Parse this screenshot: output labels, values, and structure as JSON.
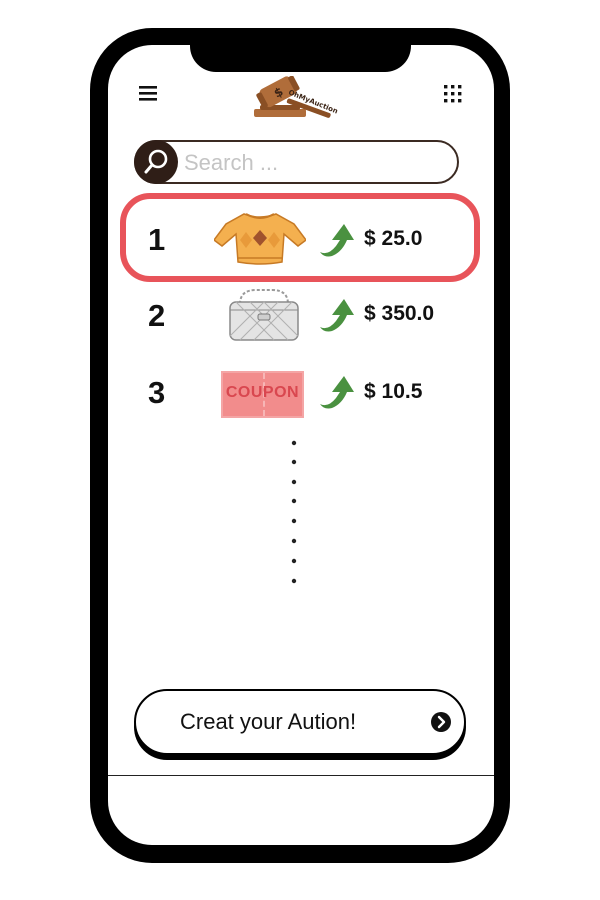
{
  "app": {
    "logo_text": "OhMyAuction"
  },
  "header": {
    "menu_icon": "hamburger-menu-icon",
    "apps_icon": "grid-dots-icon"
  },
  "search": {
    "placeholder": "Search ...",
    "value": "",
    "icon": "search-icon"
  },
  "items": [
    {
      "rank": "1",
      "image": "sweater",
      "trend_icon": "up-arrow-icon",
      "price": "$ 25.0",
      "highlighted": true
    },
    {
      "rank": "2",
      "image": "handbag",
      "trend_icon": "up-arrow-icon",
      "price": "$ 350.0",
      "highlighted": false
    },
    {
      "rank": "3",
      "image": "coupon",
      "image_text": "COUPON",
      "trend_icon": "up-arrow-icon",
      "price": "$ 10.5",
      "highlighted": false
    }
  ],
  "cta": {
    "label": "Creat your Aution!",
    "icon": "chevron-right-circle-icon"
  },
  "colors": {
    "highlight": "#e8545a",
    "trend": "#4a9140",
    "search_border": "#3b2a22",
    "logo_brown": "#b06d3a"
  }
}
